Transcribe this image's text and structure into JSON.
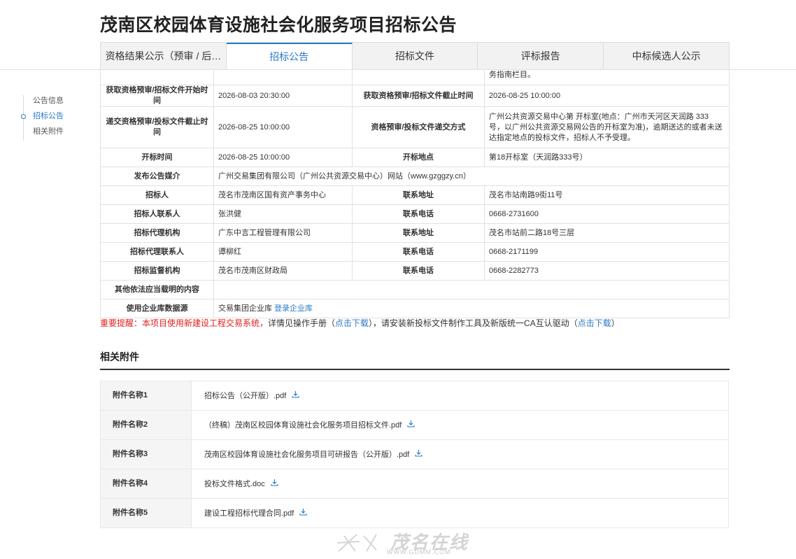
{
  "page": {
    "title": "茂南区校园体育设施社会化服务项目招标公告"
  },
  "tabs": [
    "资格结果公示（预审 / 后…",
    "招标公告",
    "招标文件",
    "评标报告",
    "中标候选人公示"
  ],
  "sidenav": [
    "公告信息",
    "招标公告",
    "相关附件"
  ],
  "info_rows": {
    "r0": {
      "v3": "务指南栏目。"
    },
    "r1": {
      "k1": "获取资格预审/招标文件开始时间",
      "v1": "2026-08-03 20:30:00",
      "k2": "获取资格预审/招标文件截止时间",
      "v2": "2026-08-25 10:00:00"
    },
    "r2": {
      "k1": "递交资格预审/投标文件截止时间",
      "v1": "2026-08-25 10:00:00",
      "k2": "资格预审/投标文件递交方式",
      "v2": "广州公共资源交易中心第 开标室(地点：广州市天河区天润路 333 号，以广州公共资源交易网公告的开标室为准)，逾期送达的或者未送达指定地点的投标文件，招标人不予受理。"
    },
    "r3": {
      "k1": "开标时间",
      "v1": "2026-08-25 10:00:00",
      "k2": "开标地点",
      "v2": "第18开标室（天润路333号）"
    },
    "r4": {
      "k1": "发布公告媒介",
      "v1": "广州交易集团有限公司（广州公共资源交易中心）网站（www.gzggzy.cn）"
    },
    "r5": {
      "k1": "招标人",
      "v1": "茂名市茂南区国有资产事务中心",
      "k2": "联系地址",
      "v2": "茂名市站南路9街11号"
    },
    "r6": {
      "k1": "招标人联系人",
      "v1": "张洪健",
      "k2": "联系电话",
      "v2": "0668-2731600"
    },
    "r7": {
      "k1": "招标代理机构",
      "v1": "广东中言工程管理有限公司",
      "k2": "联系地址",
      "v2": "茂名市站前二路18号三层"
    },
    "r8": {
      "k1": "招标代理联系人",
      "v1": "谭柳红",
      "k2": "联系电话",
      "v2": "0668-2171199"
    },
    "r9": {
      "k1": "招标监督机构",
      "v1": "茂名市茂南区财政局",
      "k2": "联系电话",
      "v2": "0668-2282773"
    },
    "r10": {
      "k1": "其他依法应当载明的内容",
      "v1": ""
    },
    "r11": {
      "k1": "使用企业库数据源",
      "v1": "交易集团企业库",
      "link": "登录企业库"
    }
  },
  "notice": {
    "red": "重要提醒：本项目使用新建设工程交易系统，",
    "t1": "详情见操作手册（",
    "l1": "点击下载",
    "t2": "），请安装新投标文件制作工具及新版统一CA互认驱动（",
    "l2": "点击下载",
    "t3": "）"
  },
  "attachments": {
    "title": "相关附件",
    "items": [
      {
        "key": "附件名称1",
        "name": "招标公告（公开版）.pdf"
      },
      {
        "key": "附件名称2",
        "name": "（终稿）茂南区校园体育设施社会化服务项目招标文件.pdf"
      },
      {
        "key": "附件名称3",
        "name": "茂南区校园体育设施社会化服务项目可研报告（公开版）.pdf"
      },
      {
        "key": "附件名称4",
        "name": "投标文件格式.doc"
      },
      {
        "key": "附件名称5",
        "name": "建设工程招标代理合同.pdf"
      }
    ]
  },
  "watermark": {
    "big": "茂名在线",
    "small": "WWW.GDMM.COM"
  },
  "colors": {
    "accent": "#2a7ac7",
    "alert": "#e02020"
  }
}
